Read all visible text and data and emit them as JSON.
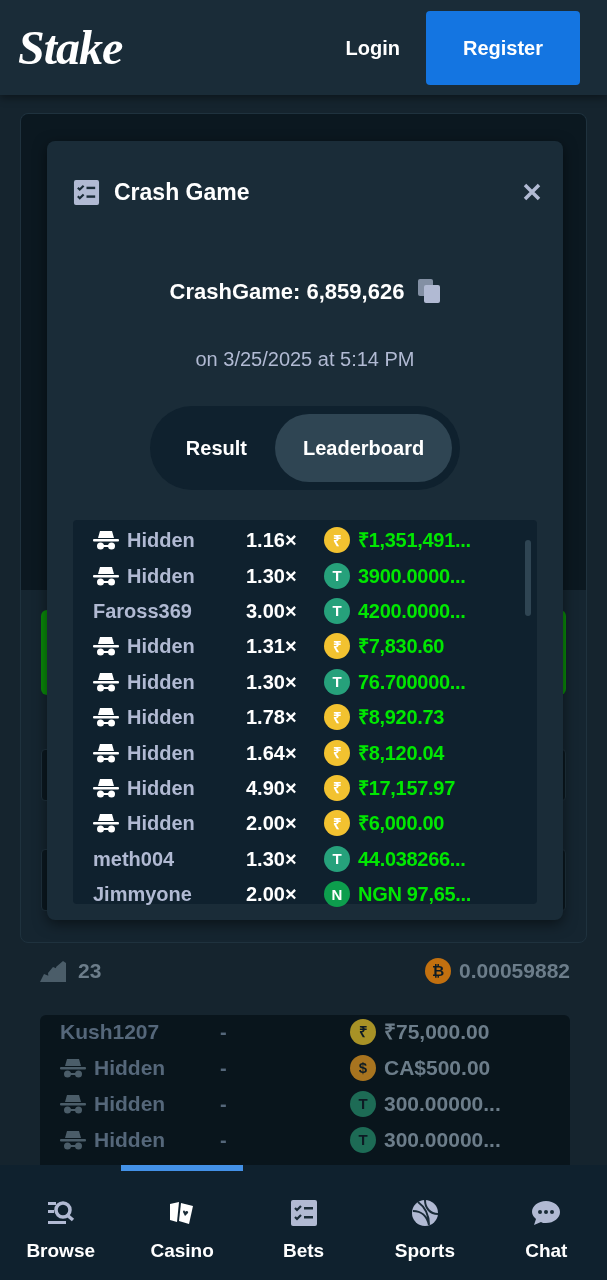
{
  "header": {
    "logo": "Stake",
    "login": "Login",
    "register": "Register"
  },
  "modal": {
    "title": "Crash Game",
    "game_id": "CrashGame: 6,859,626",
    "date": "on 3/25/2025 at 5:14 PM",
    "tabs": [
      {
        "label": "Result",
        "selected": false
      },
      {
        "label": "Leaderboard",
        "selected": true
      }
    ],
    "rows": [
      {
        "name": "Hidden",
        "hidden": true,
        "multiplier": "1.16×",
        "coin": {
          "symbol": "₹",
          "color": "#f2c230"
        },
        "amount": "₹1,351,491..."
      },
      {
        "name": "Hidden",
        "hidden": true,
        "multiplier": "1.30×",
        "coin": {
          "symbol": "T",
          "color": "#26a17b"
        },
        "amount": "3900.0000..."
      },
      {
        "name": "Faross369",
        "hidden": false,
        "multiplier": "3.00×",
        "coin": {
          "symbol": "T",
          "color": "#26a17b"
        },
        "amount": "4200.0000..."
      },
      {
        "name": "Hidden",
        "hidden": true,
        "multiplier": "1.31×",
        "coin": {
          "symbol": "₹",
          "color": "#f2c230"
        },
        "amount": "₹7,830.60"
      },
      {
        "name": "Hidden",
        "hidden": true,
        "multiplier": "1.30×",
        "coin": {
          "symbol": "T",
          "color": "#26a17b"
        },
        "amount": "76.700000..."
      },
      {
        "name": "Hidden",
        "hidden": true,
        "multiplier": "1.78×",
        "coin": {
          "symbol": "₹",
          "color": "#f2c230"
        },
        "amount": "₹8,920.73"
      },
      {
        "name": "Hidden",
        "hidden": true,
        "multiplier": "1.64×",
        "coin": {
          "symbol": "₹",
          "color": "#f2c230"
        },
        "amount": "₹8,120.04"
      },
      {
        "name": "Hidden",
        "hidden": true,
        "multiplier": "4.90×",
        "coin": {
          "symbol": "₹",
          "color": "#f2c230"
        },
        "amount": "₹17,157.97"
      },
      {
        "name": "Hidden",
        "hidden": true,
        "multiplier": "2.00×",
        "coin": {
          "symbol": "₹",
          "color": "#f2c230"
        },
        "amount": "₹6,000.00"
      },
      {
        "name": "meth004",
        "hidden": false,
        "multiplier": "1.30×",
        "coin": {
          "symbol": "T",
          "color": "#26a17b"
        },
        "amount": "44.038266..."
      },
      {
        "name": "Jimmyone",
        "hidden": false,
        "multiplier": "2.00×",
        "coin": {
          "symbol": "N",
          "color": "#0d9e4d"
        },
        "amount": "NGN 97,65..."
      }
    ]
  },
  "summary": {
    "players": "23",
    "total_coin": {
      "symbol": "₿",
      "color": "#c2700f"
    },
    "total": "0.00059882"
  },
  "bets": [
    {
      "name": "Kush1207",
      "hidden": false,
      "multiplier": "-",
      "coin": {
        "symbol": "₹",
        "color": "#a89226"
      },
      "amount": "₹75,000.00"
    },
    {
      "name": "Hidden",
      "hidden": true,
      "multiplier": "-",
      "coin": {
        "symbol": "$",
        "color": "#a8741f"
      },
      "amount": "CA$500.00"
    },
    {
      "name": "Hidden",
      "hidden": true,
      "multiplier": "-",
      "coin": {
        "symbol": "T",
        "color": "#1d6b55"
      },
      "amount": "300.00000..."
    },
    {
      "name": "Hidden",
      "hidden": true,
      "multiplier": "-",
      "coin": {
        "symbol": "T",
        "color": "#1d6b55"
      },
      "amount": "300.00000..."
    }
  ],
  "nav": [
    {
      "label": "Browse",
      "selected": false
    },
    {
      "label": "Casino",
      "selected": true
    },
    {
      "label": "Bets",
      "selected": false
    },
    {
      "label": "Sports",
      "selected": false
    },
    {
      "label": "Chat",
      "selected": false
    }
  ]
}
